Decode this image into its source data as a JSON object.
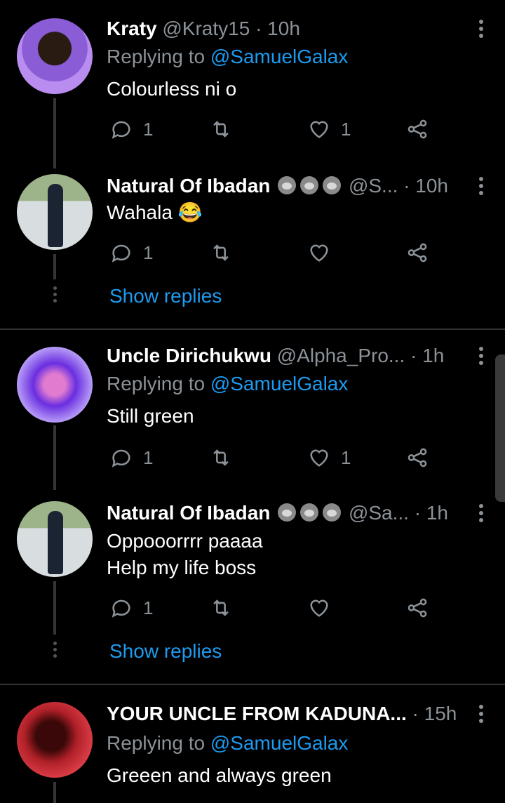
{
  "tweets": [
    {
      "name": "Kraty",
      "handle": "@Kraty15",
      "time": "· 10h",
      "replying_prefix": "Replying to ",
      "replying_user": "@SamuelGalax",
      "text": "Colourless ni o",
      "replies": "1",
      "likes": "1",
      "avatar_colors": [
        "#6a3cc9",
        "#b98cf0"
      ]
    },
    {
      "name": "Natural Of Ibadan",
      "handle": "@S...",
      "time": "· 10h",
      "text": "Wahala 😂",
      "replies": "1",
      "likes": "",
      "avatar_colors": [
        "#9db38a",
        "#d8dde0"
      ]
    },
    {
      "name": "Uncle Dirichukwu",
      "handle": "@Alpha_Pro...",
      "time": "· 1h",
      "replying_prefix": "Replying to ",
      "replying_user": "@SamuelGalax",
      "text": "Still green",
      "replies": "1",
      "likes": "1",
      "avatar_colors": [
        "#5b2bd8",
        "#b69bf7"
      ]
    },
    {
      "name": "Natural Of Ibadan",
      "handle": "@Sa...",
      "time": "· 1h",
      "text_line1": "Oppooorrrr paaaa",
      "text_line2": "Help my life boss",
      "replies": "1",
      "likes": "",
      "avatar_colors": [
        "#9db38a",
        "#d8dde0"
      ]
    },
    {
      "name": "YOUR UNCLE FROM KADUNA...",
      "time": "· 15h",
      "replying_prefix": "Replying to ",
      "replying_user": "@SamuelGalax",
      "text": "Greeen and always green",
      "avatar_colors": [
        "#7a1010",
        "#e0404a"
      ]
    }
  ],
  "show_replies_label": "Show replies",
  "icons": [
    "reply-icon",
    "retweet-icon",
    "like-icon",
    "share-icon",
    "more-icon",
    "gorilla-emoji"
  ],
  "colors": {
    "accent": "#1d9bf0",
    "muted": "#8b9298",
    "background": "#000000"
  }
}
